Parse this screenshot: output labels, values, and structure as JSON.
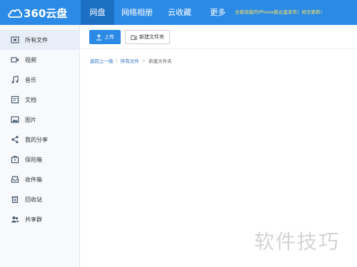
{
  "topbar": {
    "logo_text": "360云盘",
    "nav": [
      {
        "label": "网盘",
        "active": true
      },
      {
        "label": "网络相册"
      },
      {
        "label": "云收藏"
      },
      {
        "label": "更多"
      }
    ],
    "notice": "全新改版的iPhone版云盘发布！抢去更新！"
  },
  "sidebar": {
    "items": [
      {
        "label": "所有文件",
        "icon": "all-files-icon",
        "active": true
      },
      {
        "label": "视频",
        "icon": "video-icon"
      },
      {
        "label": "音乐",
        "icon": "music-icon"
      },
      {
        "label": "文档",
        "icon": "document-icon"
      },
      {
        "label": "图片",
        "icon": "image-icon"
      },
      {
        "label": "我的分享",
        "icon": "share-icon"
      },
      {
        "label": "保险箱",
        "icon": "safe-icon"
      },
      {
        "label": "收件箱",
        "icon": "inbox-icon"
      },
      {
        "label": "回收站",
        "icon": "trash-icon"
      },
      {
        "label": "共享群",
        "icon": "group-icon"
      }
    ]
  },
  "toolbar": {
    "upload_label": "上传",
    "new_folder_label": "新建文件夹"
  },
  "breadcrumb": {
    "back": "返回上一级",
    "root": "所有文件",
    "current": "新建文件夹"
  },
  "watermark": "软件技巧",
  "colors": {
    "brand_blue": "#2b8ae6",
    "nav_active": "#1d6fc4",
    "notice_yellow": "#ffe35a"
  }
}
